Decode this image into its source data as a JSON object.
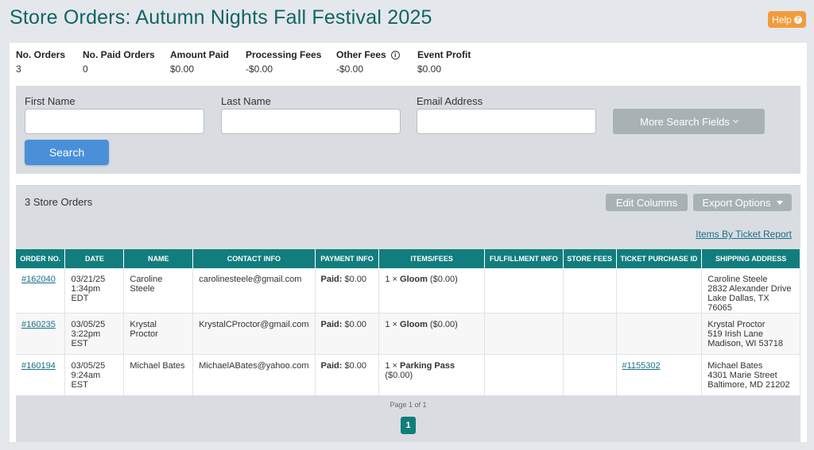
{
  "page": {
    "title": "Store Orders: Autumn Nights Fall Festival 2025",
    "help_label": "Help"
  },
  "stats": [
    {
      "label": "No. Orders",
      "value": "3"
    },
    {
      "label": "No. Paid Orders",
      "value": "0"
    },
    {
      "label": "Amount Paid",
      "value": "$0.00"
    },
    {
      "label": "Processing Fees",
      "value": "-$0.00"
    },
    {
      "label": "Other Fees",
      "value": "-$0.00"
    },
    {
      "label": "Event Profit",
      "value": "$0.00"
    }
  ],
  "search": {
    "first_name_label": "First Name",
    "last_name_label": "Last Name",
    "email_label": "Email Address",
    "first_name_value": "",
    "last_name_value": "",
    "email_value": "",
    "more_fields_label": "More Search Fields",
    "search_label": "Search"
  },
  "orders": {
    "count_label": "3 Store Orders",
    "edit_columns_label": "Edit Columns",
    "export_label": "Export Options",
    "items_report_label": "Items By Ticket Report",
    "columns": [
      "Order No.",
      "Date",
      "Name",
      "Contact Info",
      "Payment Info",
      "Items/Fees",
      "Fulfillment Info",
      "Store Fees",
      "Ticket Purchase ID",
      "Shipping Address"
    ],
    "rows": [
      {
        "order_no": "#162040",
        "date_line1": "03/21/25",
        "date_line2": "1:34pm EDT",
        "name": "Caroline Steele",
        "contact": "carolinesteele@gmail.com",
        "paid_label": "Paid:",
        "paid_value": "$0.00",
        "item_qty": "1 ×",
        "item_name": "Gloom",
        "item_price": "($0.00)",
        "fulfillment": "",
        "store_fees": "",
        "ticket_id": "",
        "ship_name": "Caroline Steele",
        "ship_street": "2832 Alexander Drive",
        "ship_city": "Lake Dallas, TX 76065"
      },
      {
        "order_no": "#160235",
        "date_line1": "03/05/25",
        "date_line2": "3:22pm EST",
        "name": "Krystal Proctor",
        "contact": "KrystalCProctor@gmail.com",
        "paid_label": "Paid:",
        "paid_value": "$0.00",
        "item_qty": "1 ×",
        "item_name": "Gloom",
        "item_price": "($0.00)",
        "fulfillment": "",
        "store_fees": "",
        "ticket_id": "",
        "ship_name": "Krystal Proctor",
        "ship_street": "519 Irish Lane",
        "ship_city": "Madison, WI 53718"
      },
      {
        "order_no": "#160194",
        "date_line1": "03/05/25",
        "date_line2": "9:24am EST",
        "name": "Michael Bates",
        "contact": "MichaelABates@yahoo.com",
        "paid_label": "Paid:",
        "paid_value": "$0.00",
        "item_qty": "1 ×",
        "item_name": "Parking Pass",
        "item_price": "($0.00)",
        "fulfillment": "",
        "store_fees": "",
        "ticket_id": "#1155302",
        "ship_name": "Michael Bates",
        "ship_street": "4301 Marie Street",
        "ship_city": "Baltimore, MD 21202"
      }
    ]
  },
  "pagination": {
    "label": "Page 1 of 1",
    "current_page": "1"
  },
  "colors": {
    "title": "#116466",
    "header": "#127d7d",
    "help": "#f29b3c",
    "search_button": "#4a90d9",
    "link": "#1a6e8a"
  }
}
